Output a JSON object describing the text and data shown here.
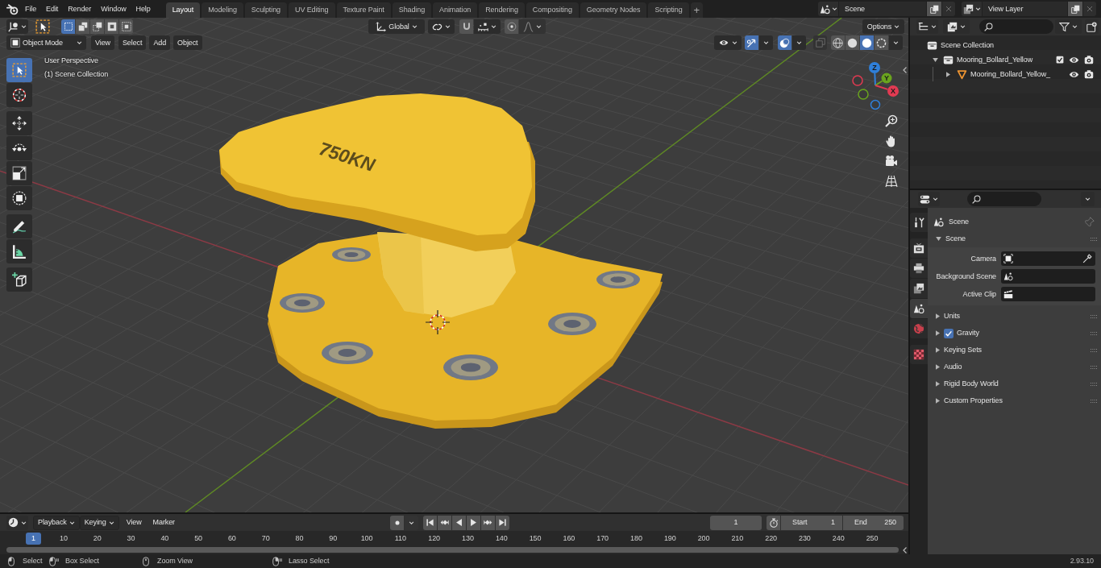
{
  "topbar": {
    "menus": [
      "File",
      "Edit",
      "Render",
      "Window",
      "Help"
    ],
    "workspaces": [
      {
        "label": "Layout",
        "selected": true
      },
      {
        "label": "Modeling",
        "selected": false
      },
      {
        "label": "Sculpting",
        "selected": false
      },
      {
        "label": "UV Editing",
        "selected": false
      },
      {
        "label": "Texture Paint",
        "selected": false
      },
      {
        "label": "Shading",
        "selected": false
      },
      {
        "label": "Animation",
        "selected": false
      },
      {
        "label": "Rendering",
        "selected": false
      },
      {
        "label": "Compositing",
        "selected": false
      },
      {
        "label": "Geometry Nodes",
        "selected": false
      },
      {
        "label": "Scripting",
        "selected": false
      }
    ],
    "add_tab": "+",
    "scene": "Scene",
    "view_layer": "View Layer"
  },
  "viewport": {
    "select_modes": [
      {
        "selected": true
      },
      {
        "selected": false
      },
      {
        "selected": false
      },
      {
        "selected": false
      },
      {
        "selected": false
      }
    ],
    "orientation": "Global",
    "mode": "Object Mode",
    "menus": [
      "View",
      "Select",
      "Add",
      "Object"
    ],
    "options": "Options",
    "gizmos_on": true,
    "overlays_on": true,
    "xray_on": false,
    "shading": [
      {
        "kind": "wireframe",
        "selected": false
      },
      {
        "kind": "solid",
        "selected": false
      },
      {
        "kind": "material",
        "selected": true
      },
      {
        "kind": "rendered",
        "selected": false
      }
    ],
    "tool_groups": [
      [
        {
          "kind": "select",
          "selected": true
        },
        {
          "kind": "cursor",
          "selected": false
        }
      ],
      [
        {
          "kind": "move",
          "selected": false
        },
        {
          "kind": "rotate",
          "selected": false
        },
        {
          "kind": "scale",
          "selected": false
        },
        {
          "kind": "transform",
          "selected": false
        }
      ],
      [
        {
          "kind": "annotate",
          "selected": false
        },
        {
          "kind": "measure",
          "selected": false
        }
      ],
      [
        {
          "kind": "addcube",
          "selected": false
        }
      ]
    ],
    "overlay_text": [
      "User Perspective",
      "(1) Scene Collection"
    ],
    "model_label": "750KN",
    "gizmo_axes": [
      {
        "label": "Z",
        "color": "#2f7fd9"
      },
      {
        "label": "Y",
        "color": "#6aa41e"
      },
      {
        "label": "X",
        "color": "#e23a52"
      }
    ]
  },
  "outliner": {
    "tree": [
      {
        "label": "Scene Collection",
        "kind": "scene",
        "children": [
          {
            "label": "Mooring_Bollard_Yellow",
            "kind": "collection",
            "expanded": true,
            "checked": true,
            "children": [
              {
                "label": "Mooring_Bollard_Yellow_",
                "kind": "mesh",
                "expanded": false
              }
            ]
          }
        ]
      }
    ]
  },
  "properties": {
    "tab_groups": [
      [
        {
          "kind": "tool",
          "selected": false
        }
      ],
      [
        {
          "kind": "render",
          "selected": false
        },
        {
          "kind": "output",
          "selected": false
        },
        {
          "kind": "viewlayer",
          "selected": false
        },
        {
          "kind": "scene",
          "selected": true
        },
        {
          "kind": "world",
          "selected": false
        }
      ],
      [
        {
          "kind": "texture",
          "selected": false
        }
      ]
    ],
    "context": "Scene",
    "panels": [
      {
        "title": "Scene",
        "expanded": true,
        "fields": [
          {
            "label": "Camera",
            "kind": "camera"
          },
          {
            "label": "Background Scene",
            "kind": "scene"
          },
          {
            "label": "Active Clip",
            "kind": "clip"
          }
        ]
      },
      {
        "title": "Units",
        "expanded": false
      },
      {
        "title": "Gravity",
        "expanded": false,
        "checked": true
      },
      {
        "title": "Keying Sets",
        "expanded": false
      },
      {
        "title": "Audio",
        "expanded": false
      },
      {
        "title": "Rigid Body World",
        "expanded": false
      },
      {
        "title": "Custom Properties",
        "expanded": false
      }
    ]
  },
  "timeline": {
    "menus": [
      {
        "label": "Playback",
        "kind": "dropdown"
      },
      {
        "label": "Keying",
        "kind": "dropdown"
      },
      {
        "label": "View",
        "kind": "plain"
      },
      {
        "label": "Marker",
        "kind": "plain"
      }
    ],
    "current_frame": "1",
    "start_label": "Start",
    "start": "1",
    "end_label": "End",
    "end": "250",
    "playhead": "1",
    "ruler": [
      "10",
      "20",
      "30",
      "40",
      "50",
      "60",
      "70",
      "80",
      "90",
      "100",
      "110",
      "120",
      "130",
      "140",
      "150",
      "160",
      "170",
      "180",
      "190",
      "200",
      "210",
      "220",
      "230",
      "240",
      "250"
    ]
  },
  "status_bar": {
    "hints": [
      {
        "label": "Select",
        "kind": "click"
      },
      {
        "label": "Box Select",
        "kind": "drag"
      },
      {
        "label": "Zoom View",
        "kind": "middle"
      },
      {
        "label": "Lasso Select",
        "kind": "rightdrag"
      }
    ],
    "version": "2.93.10"
  }
}
